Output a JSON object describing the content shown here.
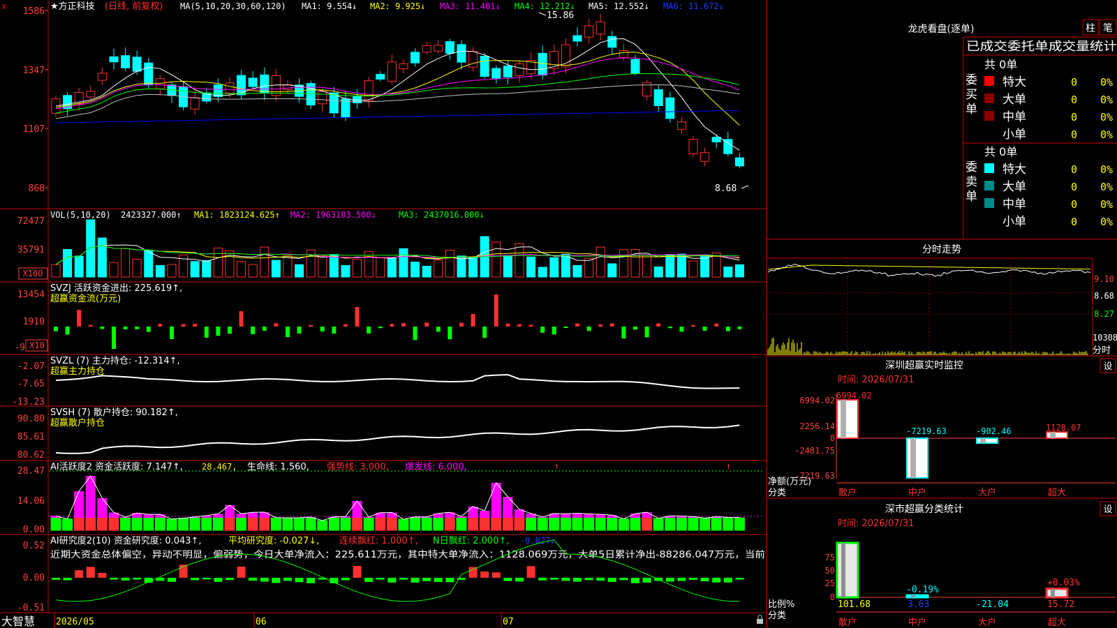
{
  "colors": {
    "up": "#ff3030",
    "down": "#00ffff",
    "border": "#c80000",
    "ma1": "#ffffff",
    "ma2": "#ffff00",
    "ma3": "#ff00ff",
    "ma4": "#00ff00",
    "ma5": "#c0c0c0",
    "ma6": "#0000ff",
    "axis_text": "#ff4040",
    "grid": "#800000"
  },
  "header": {
    "title": "★方正科技",
    "period": "(日线, 前复权)",
    "ma_label": "MA(5,10,20,30,60,120)",
    "ma1": "MA1: 9.554↓",
    "ma2": "MA2: 9.925↓",
    "ma3": "MA3: 11.401↓",
    "ma4": "MA4: 12.212↓",
    "ma5": "MA5: 12.552↓",
    "ma6": "MA6: 11.672↓"
  },
  "price_axis": [
    "1586",
    "1347",
    "1107",
    "868"
  ],
  "price_high": "15.86",
  "price_low": "8.68",
  "vol": {
    "label": "VOL(5,10,20)",
    "value": "2423327.000↑",
    "ma1": "MA1: 1823124.625↑",
    "ma2": "MA2: 1963183.500↓",
    "ma3": "MA3: 2437016.000↓",
    "axis": [
      "72477",
      "35791"
    ],
    "unit": "X100"
  },
  "svzj": {
    "label": "SVZJ  活跃资金进出: 225.619↑,",
    "sub": "超赢资金流(万元)",
    "axis": [
      "13454",
      "1910",
      "-9"
    ],
    "unit": "X10"
  },
  "svzl": {
    "label": "SVZL (7) 主力持仓: -12.314↑,",
    "sub": "超赢主力持仓",
    "axis": [
      "-2.07",
      "-7.65",
      "-13.23"
    ]
  },
  "svsh": {
    "label": "SVSH (7) 散户持仓: 90.182↑,",
    "sub": "超赢散户持仓",
    "axis": [
      "90.80",
      "85.61",
      "80.62"
    ]
  },
  "ai1": {
    "label": "AI活跃度2 资金活跃度: 7.147↑,",
    "v2": "28.467,",
    "v3": "生命线: 1.560,",
    "v4": "强势线: 3.000,",
    "v5": "爆发线: 6.000,",
    "axis": [
      "28.47",
      "14.06",
      "0.00"
    ]
  },
  "ai2": {
    "label": "AI研究度2(10) 资金研究度: 0.043↑,",
    "v2": "平均研究度: -0.027↓,",
    "v3": "连续飘红: 1.000↑,",
    "v4": "N日飘红: 2.000↑,",
    "v5": "-0.027↓",
    "commentary": "近期大资金总体偏空，异动不明显，偏弱势，今日大单净流入：225.611万元，其中特大单净流入：1128.069万元，大单5日累计净出-88286.047万元，当前",
    "axis": [
      "0.52",
      "0.00",
      "-0.51"
    ]
  },
  "dates": {
    "brand": "大智慧",
    "d1": "2026/05",
    "d2": "06",
    "d3": "07"
  },
  "dragon": {
    "title": "龙虎看盘(逐单)",
    "btn1": "柱",
    "btn2": "笔",
    "heading": "已成交委托单成交量统计",
    "buy_label": "委买单",
    "sell_label": "委卖单",
    "buy_total": "共 0单",
    "sell_total": "共 0单",
    "rows": [
      {
        "name": "特大",
        "count": "0",
        "pct": "0%"
      },
      {
        "name": "大单",
        "count": "0",
        "pct": "0%"
      },
      {
        "name": "中单",
        "count": "0",
        "pct": "0%"
      },
      {
        "name": "小单",
        "count": "0",
        "pct": "0%"
      }
    ]
  },
  "intraday": {
    "title": "分时走势",
    "axis": [
      "9.10",
      "8.68",
      "8.27"
    ],
    "vol": "10308",
    "vol_label": "分时"
  },
  "monitor": {
    "title": "深圳超赢实时监控",
    "btn": "设",
    "time": "时间: 2026/07/31",
    "axis": [
      "6994.02",
      "2256.14",
      "0",
      "-2481.75",
      "-7219.63"
    ],
    "ylabel": "净额(万元)",
    "xlabel": "分类",
    "cats": [
      "散户",
      "中户",
      "大户",
      "超大"
    ],
    "values": [
      6994.02,
      -7219.63,
      -902.46,
      1128.07
    ],
    "value_labels": [
      "6994.02",
      "-7219.63",
      "-902.46",
      "1128.07"
    ]
  },
  "classify": {
    "title": "深市超赢分类统计",
    "btn": "设",
    "time": "时间: 2026/07/31",
    "axis": [
      "75",
      "50",
      "25",
      "0"
    ],
    "ylabel": "比例%",
    "xlabel": "分类",
    "cats": [
      "散户",
      "中户",
      "大户",
      "超大"
    ],
    "bars": [
      101.68,
      3.63,
      0,
      15.72
    ],
    "bottom_vals": [
      "101.68",
      "3.63",
      "-21.04",
      "15.72"
    ],
    "top_labels": [
      "",
      "-0.19%",
      "",
      "+0.03%"
    ]
  }
}
